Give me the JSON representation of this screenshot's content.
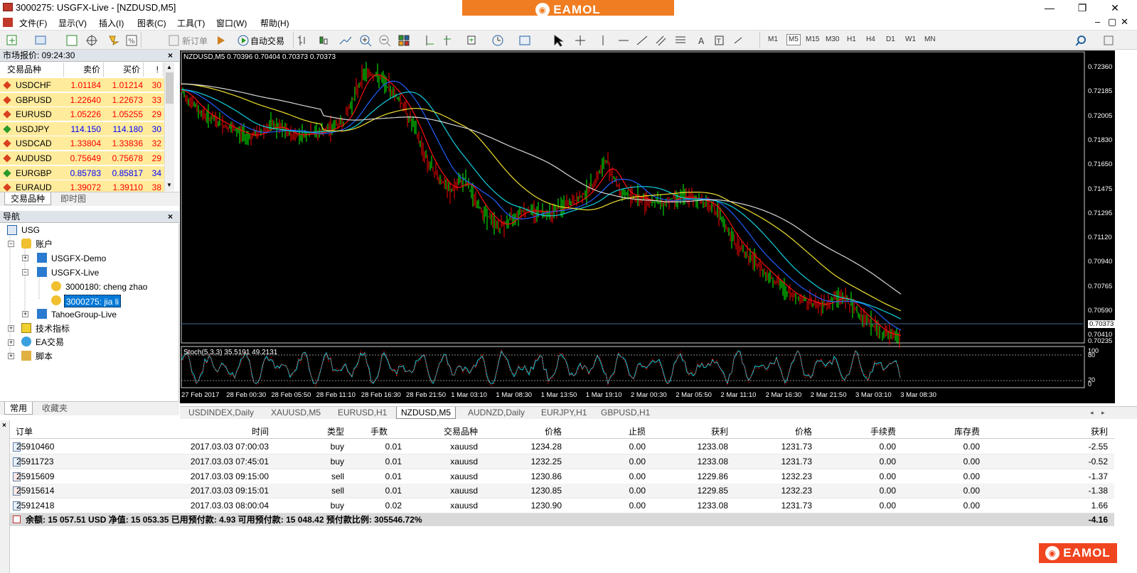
{
  "window": {
    "title": "3000275: USGFX-Live - [NZDUSD,M5]",
    "controls": [
      "—",
      "❐",
      "✕"
    ],
    "brand": "EAMOL"
  },
  "menu": [
    "文件(F)",
    "显示(V)",
    "插入(I)",
    "图表(C)",
    "工具(T)",
    "窗口(W)",
    "帮助(H)"
  ],
  "toolbar": {
    "new_order": "新订单",
    "auto_trade": "自动交易",
    "timeframes": [
      "M1",
      "M5",
      "M15",
      "M30",
      "H1",
      "H4",
      "D1",
      "W1",
      "MN"
    ],
    "active_timeframe": "M5"
  },
  "market_watch": {
    "title": "市场报价: 09:24:30",
    "columns": [
      "交易品种",
      "卖价",
      "买价",
      "!"
    ],
    "rows": [
      {
        "symbol": "USDCHF",
        "bid": "1.01184",
        "ask": "1.01214",
        "spread": "30",
        "dir": "down"
      },
      {
        "symbol": "GBPUSD",
        "bid": "1.22640",
        "ask": "1.22673",
        "spread": "33",
        "dir": "down"
      },
      {
        "symbol": "EURUSD",
        "bid": "1.05226",
        "ask": "1.05255",
        "spread": "29",
        "dir": "down"
      },
      {
        "symbol": "USDJPY",
        "bid": "114.150",
        "ask": "114.180",
        "spread": "30",
        "dir": "up"
      },
      {
        "symbol": "USDCAD",
        "bid": "1.33804",
        "ask": "1.33836",
        "spread": "32",
        "dir": "down"
      },
      {
        "symbol": "AUDUSD",
        "bid": "0.75649",
        "ask": "0.75678",
        "spread": "29",
        "dir": "down"
      },
      {
        "symbol": "EURGBP",
        "bid": "0.85783",
        "ask": "0.85817",
        "spread": "34",
        "dir": "up"
      },
      {
        "symbol": "EURAUD",
        "bid": "1.39072",
        "ask": "1.39110",
        "spread": "38",
        "dir": "down"
      }
    ],
    "tabs": [
      "交易品种",
      "即时图"
    ]
  },
  "navigator": {
    "title": "导航",
    "items": {
      "root": "USG",
      "accounts": "账户",
      "demo": "USGFX-Demo",
      "live": "USGFX-Live",
      "acct1": "3000180: cheng zhao",
      "acct2": "3000275: jia li",
      "tahoe": "TahoeGroup-Live",
      "indicators": "技术指标",
      "ea": "EA交易",
      "scripts": "脚本"
    },
    "tabs": [
      "常用",
      "收藏夹"
    ]
  },
  "chart": {
    "header": "NZDUSD,M5  0.70396 0.70404 0.70373 0.70373",
    "osc_label": "Stoch(5,3,3) 35.5191 49.2131",
    "price_labels": [
      "0.72360",
      "0.72185",
      "0.72005",
      "0.71830",
      "0.71650",
      "0.71475",
      "0.71295",
      "0.71120",
      "0.70940",
      "0.70765",
      "0.70590",
      "0.70410",
      "0.70373",
      "0.70235"
    ],
    "current_price": "0.70373",
    "osc_levels": [
      "100",
      "80",
      "20",
      "0"
    ],
    "time_labels": [
      "27 Feb 2017",
      "28 Feb 00:30",
      "28 Feb 05:50",
      "28 Feb 11:10",
      "28 Feb 16:30",
      "28 Feb 21:50",
      "1 Mar 03:10",
      "1 Mar 08:30",
      "1 Mar 13:50",
      "1 Mar 19:10",
      "2 Mar 00:30",
      "2 Mar 05:50",
      "2 Mar 11:10",
      "2 Mar 16:30",
      "2 Mar 21:50",
      "3 Mar 03:10",
      "3 Mar 08:30"
    ],
    "colors": {
      "bull": "#00ff00",
      "bear": "#ff0000",
      "ma_red": "#ff1010",
      "ma_blue": "#2060ff",
      "ma_cyan": "#10d0e0",
      "ma_yellow": "#f0e030",
      "ma_white": "#d8d8d8"
    }
  },
  "chart_tabs": [
    "USDINDEX,Daily",
    "XAUUSD,M5",
    "EURUSD,H1",
    "NZDUSD,M5",
    "AUDNZD,Daily",
    "EURJPY,H1",
    "GBPUSD,H1"
  ],
  "active_chart_tab": "NZDUSD,M5",
  "terminal": {
    "columns": [
      "订单",
      "时间",
      "类型",
      "手数",
      "交易品种",
      "价格",
      "止损",
      "获利",
      "价格",
      "手续费",
      "库存费",
      "获利"
    ],
    "rows": [
      {
        "order": "25910460",
        "time": "2017.03.03 07:00:03",
        "type": "buy",
        "lots": "0.01",
        "symbol": "xauusd",
        "price": "1234.28",
        "sl": "0.00",
        "tp": "1233.08",
        "cur": "1231.73",
        "comm": "0.00",
        "swap": "0.00",
        "profit": "-2.55"
      },
      {
        "order": "25911723",
        "time": "2017.03.03 07:45:01",
        "type": "buy",
        "lots": "0.01",
        "symbol": "xauusd",
        "price": "1232.25",
        "sl": "0.00",
        "tp": "1233.08",
        "cur": "1231.73",
        "comm": "0.00",
        "swap": "0.00",
        "profit": "-0.52"
      },
      {
        "order": "25915609",
        "time": "2017.03.03 09:15:00",
        "type": "sell",
        "lots": "0.01",
        "symbol": "xauusd",
        "price": "1230.86",
        "sl": "0.00",
        "tp": "1229.86",
        "cur": "1232.23",
        "comm": "0.00",
        "swap": "0.00",
        "profit": "-1.37"
      },
      {
        "order": "25915614",
        "time": "2017.03.03 09:15:01",
        "type": "sell",
        "lots": "0.01",
        "symbol": "xauusd",
        "price": "1230.85",
        "sl": "0.00",
        "tp": "1229.85",
        "cur": "1232.23",
        "comm": "0.00",
        "swap": "0.00",
        "profit": "-1.38"
      },
      {
        "order": "25912418",
        "time": "2017.03.03 08:00:04",
        "type": "buy",
        "lots": "0.02",
        "symbol": "xauusd",
        "price": "1230.90",
        "sl": "0.00",
        "tp": "1233.08",
        "cur": "1231.73",
        "comm": "0.00",
        "swap": "0.00",
        "profit": "1.66"
      }
    ],
    "balance_text": "余额: 15 057.51 USD  净值: 15 053.35  已用预付款: 4.93  可用预付款: 15 048.42  预付款比例: 305546.72%",
    "total_profit": "-4.16"
  },
  "brand_bottom": "EAMOL"
}
